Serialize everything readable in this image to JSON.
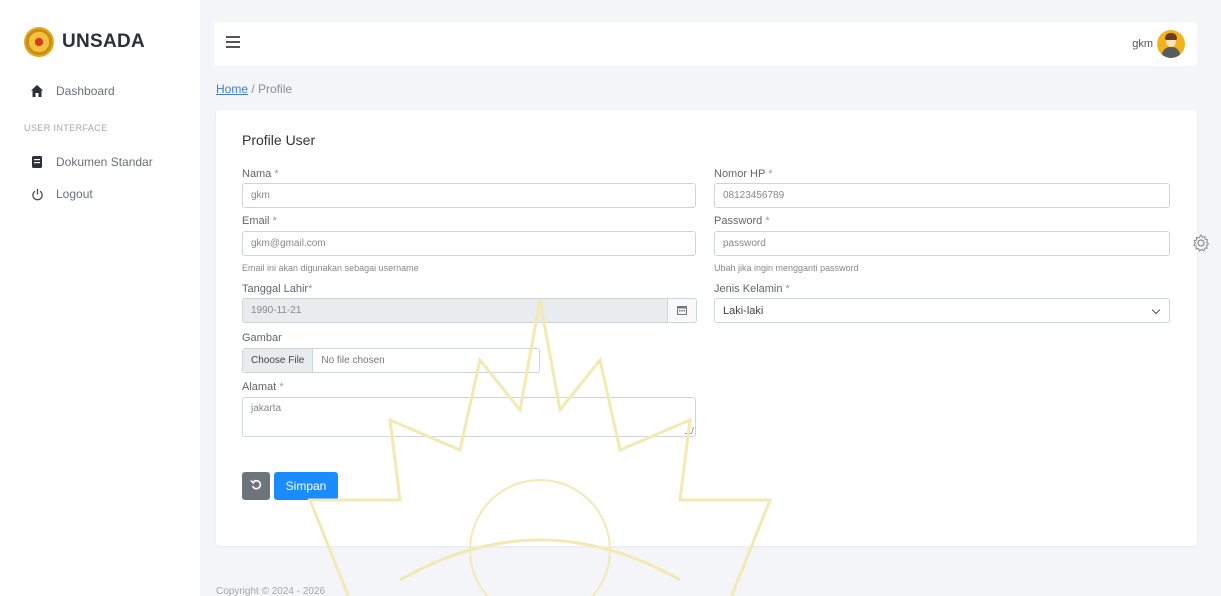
{
  "brand": {
    "name": "UNSADA"
  },
  "sidebar": {
    "items": [
      {
        "label": "Dashboard",
        "icon": "home-icon"
      },
      {
        "label": "Dokumen Standar",
        "icon": "book-icon"
      },
      {
        "label": "Logout",
        "icon": "power-icon"
      }
    ],
    "section_label": "USER INTERFACE"
  },
  "topbar": {
    "user_name": "gkm",
    "menu_icon": "hamburger-icon"
  },
  "breadcrumb": {
    "home": "Home",
    "separator": " / ",
    "current": "Profile"
  },
  "form": {
    "title": "Profile User",
    "nama": {
      "label": "Nama",
      "required": "*",
      "value": "gkm"
    },
    "nomor_hp": {
      "label": "Nomor HP",
      "required": "*",
      "value": "08123456789"
    },
    "email": {
      "label": "Email",
      "required": "*",
      "value": "gkm@gmail.com",
      "hint": "Email ini akan digunakan sebagai username"
    },
    "password": {
      "label": "Password",
      "required": "*",
      "value": "password",
      "hint": "Ubah jika ingin mengganti password"
    },
    "tanggal_lahir": {
      "label": "Tanggal Lahir",
      "required": "*",
      "value": "1990-11-21"
    },
    "jenis_kelamin": {
      "label": "Jenis Kelamin",
      "required": "*",
      "value": "Laki-laki"
    },
    "gambar": {
      "label": "Gambar",
      "button": "Choose File",
      "status": "No file chosen"
    },
    "alamat": {
      "label": "Alamat",
      "required": "*",
      "value": "jakarta"
    },
    "save_label": "Simpan"
  },
  "footer": {
    "text": "Copyright © 2024 - 2026"
  },
  "colors": {
    "primary": "#1a8cff",
    "secondary": "#6c757d",
    "accent": "#f1b21c",
    "link": "#3b7ddd"
  }
}
